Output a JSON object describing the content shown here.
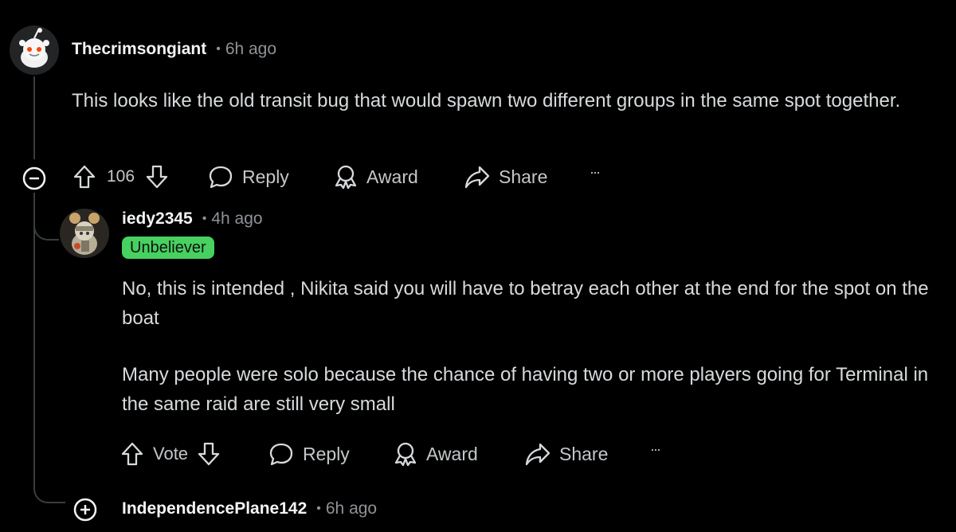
{
  "comments": [
    {
      "username": "Thecrimsongiant",
      "separator": "•",
      "time": "6h ago",
      "body": [
        "This looks like the old transit bug that would spawn two different groups in the same spot together."
      ],
      "votes": "106",
      "actions": {
        "reply": "Reply",
        "award": "Award",
        "share": "Share",
        "more": "···"
      },
      "avatar_icon": "reddit-snoo-avatar",
      "collapse_icon": "minus-circle-icon"
    },
    {
      "username": "iedy2345",
      "separator": "•",
      "time": "4h ago",
      "flair": "Unbeliever",
      "flair_color": "#46d160",
      "body": [
        "No, this is intended , Nikita said you will have to betray each other at the end for the spot on the boat",
        "Many people were solo because the chance of having two or more players going for Terminal in the same raid are still very small"
      ],
      "votes": "Vote",
      "actions": {
        "reply": "Reply",
        "award": "Award",
        "share": "Share",
        "more": "···"
      },
      "avatar_icon": "character-avatar"
    },
    {
      "username": "IndependencePlane142",
      "separator": "•",
      "time": "6h ago",
      "expand_icon": "plus-circle-icon"
    }
  ],
  "colors": {
    "background": "#000000",
    "text": "#d7dadc",
    "muted": "#8e9296",
    "thread_line": "#3a3d40"
  }
}
